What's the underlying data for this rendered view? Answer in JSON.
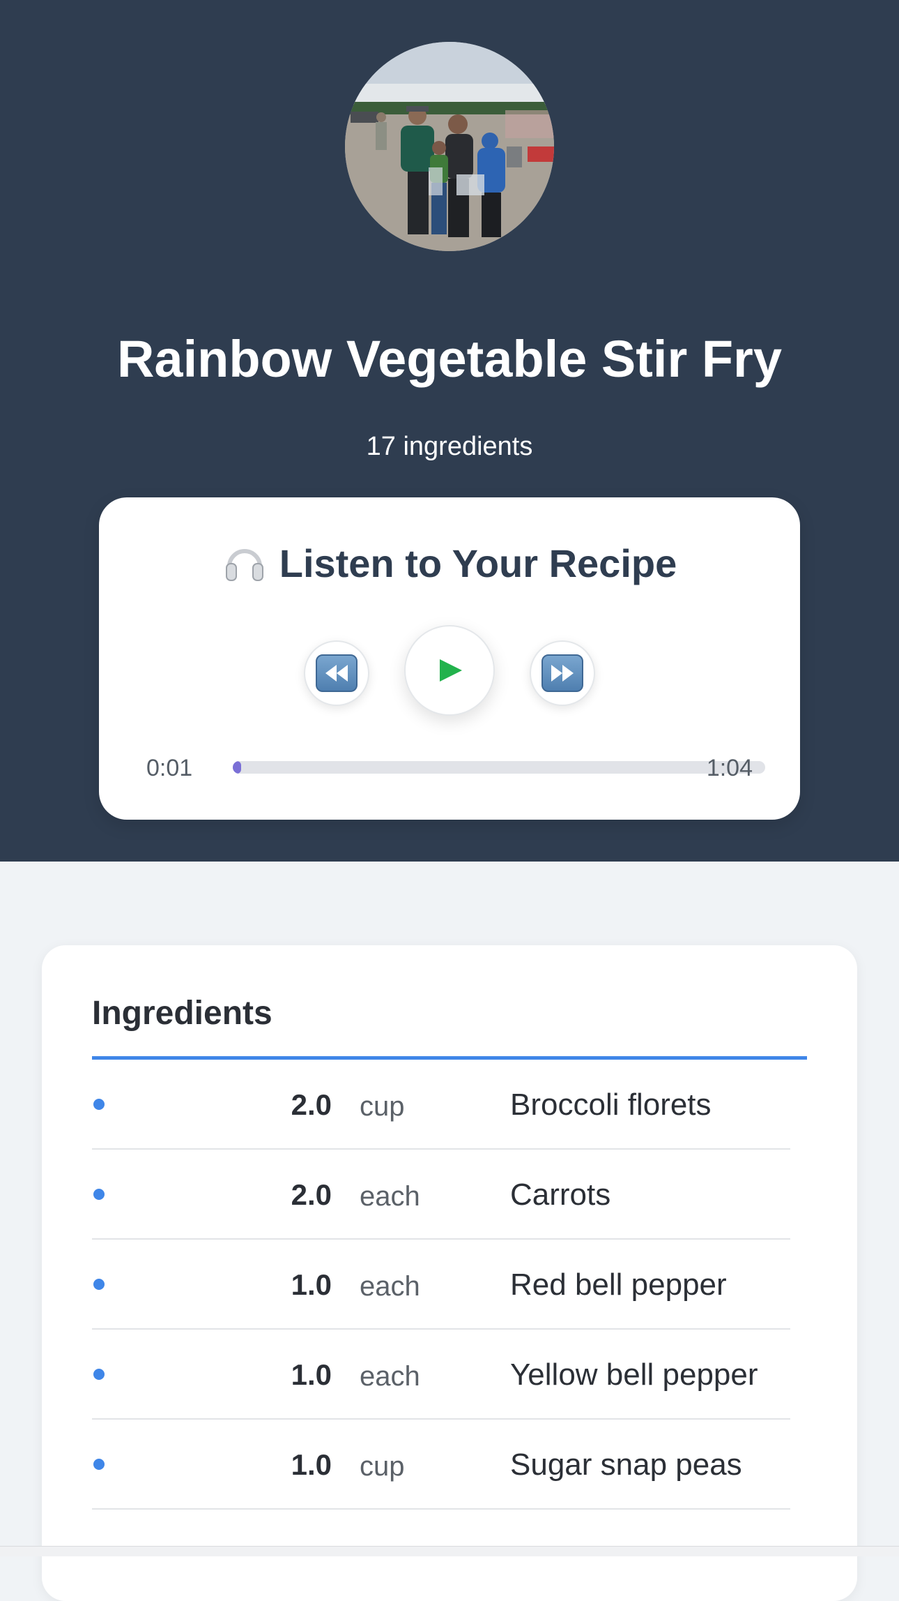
{
  "recipe": {
    "title": "Rainbow Vegetable Stir Fry",
    "ingredient_count": "17 ingredients"
  },
  "player": {
    "heading": "Listen to Your Recipe",
    "heading_icon": "headphones-icon",
    "current_time": "0:01",
    "total_time": "1:04",
    "progress": 0.016,
    "buttons": {
      "rewind": "rewind-icon",
      "play": "play-icon",
      "fast_forward": "fast-forward-icon"
    },
    "play_color": "#22b24c",
    "progress_color": "#7a6fd6"
  },
  "ingredients": {
    "title": "Ingredients",
    "accent": "#3f86e8",
    "items": [
      {
        "qty": "2.0",
        "unit": "cup",
        "name": "Broccoli florets"
      },
      {
        "qty": "2.0",
        "unit": "each",
        "name": "Carrots"
      },
      {
        "qty": "1.0",
        "unit": "each",
        "name": "Red bell pepper"
      },
      {
        "qty": "1.0",
        "unit": "each",
        "name": "Yellow bell pepper"
      },
      {
        "qty": "1.0",
        "unit": "cup",
        "name": "Sugar snap peas"
      }
    ]
  },
  "colors": {
    "hero_background": "#2f3d50",
    "page_background": "#f0f3f6"
  }
}
